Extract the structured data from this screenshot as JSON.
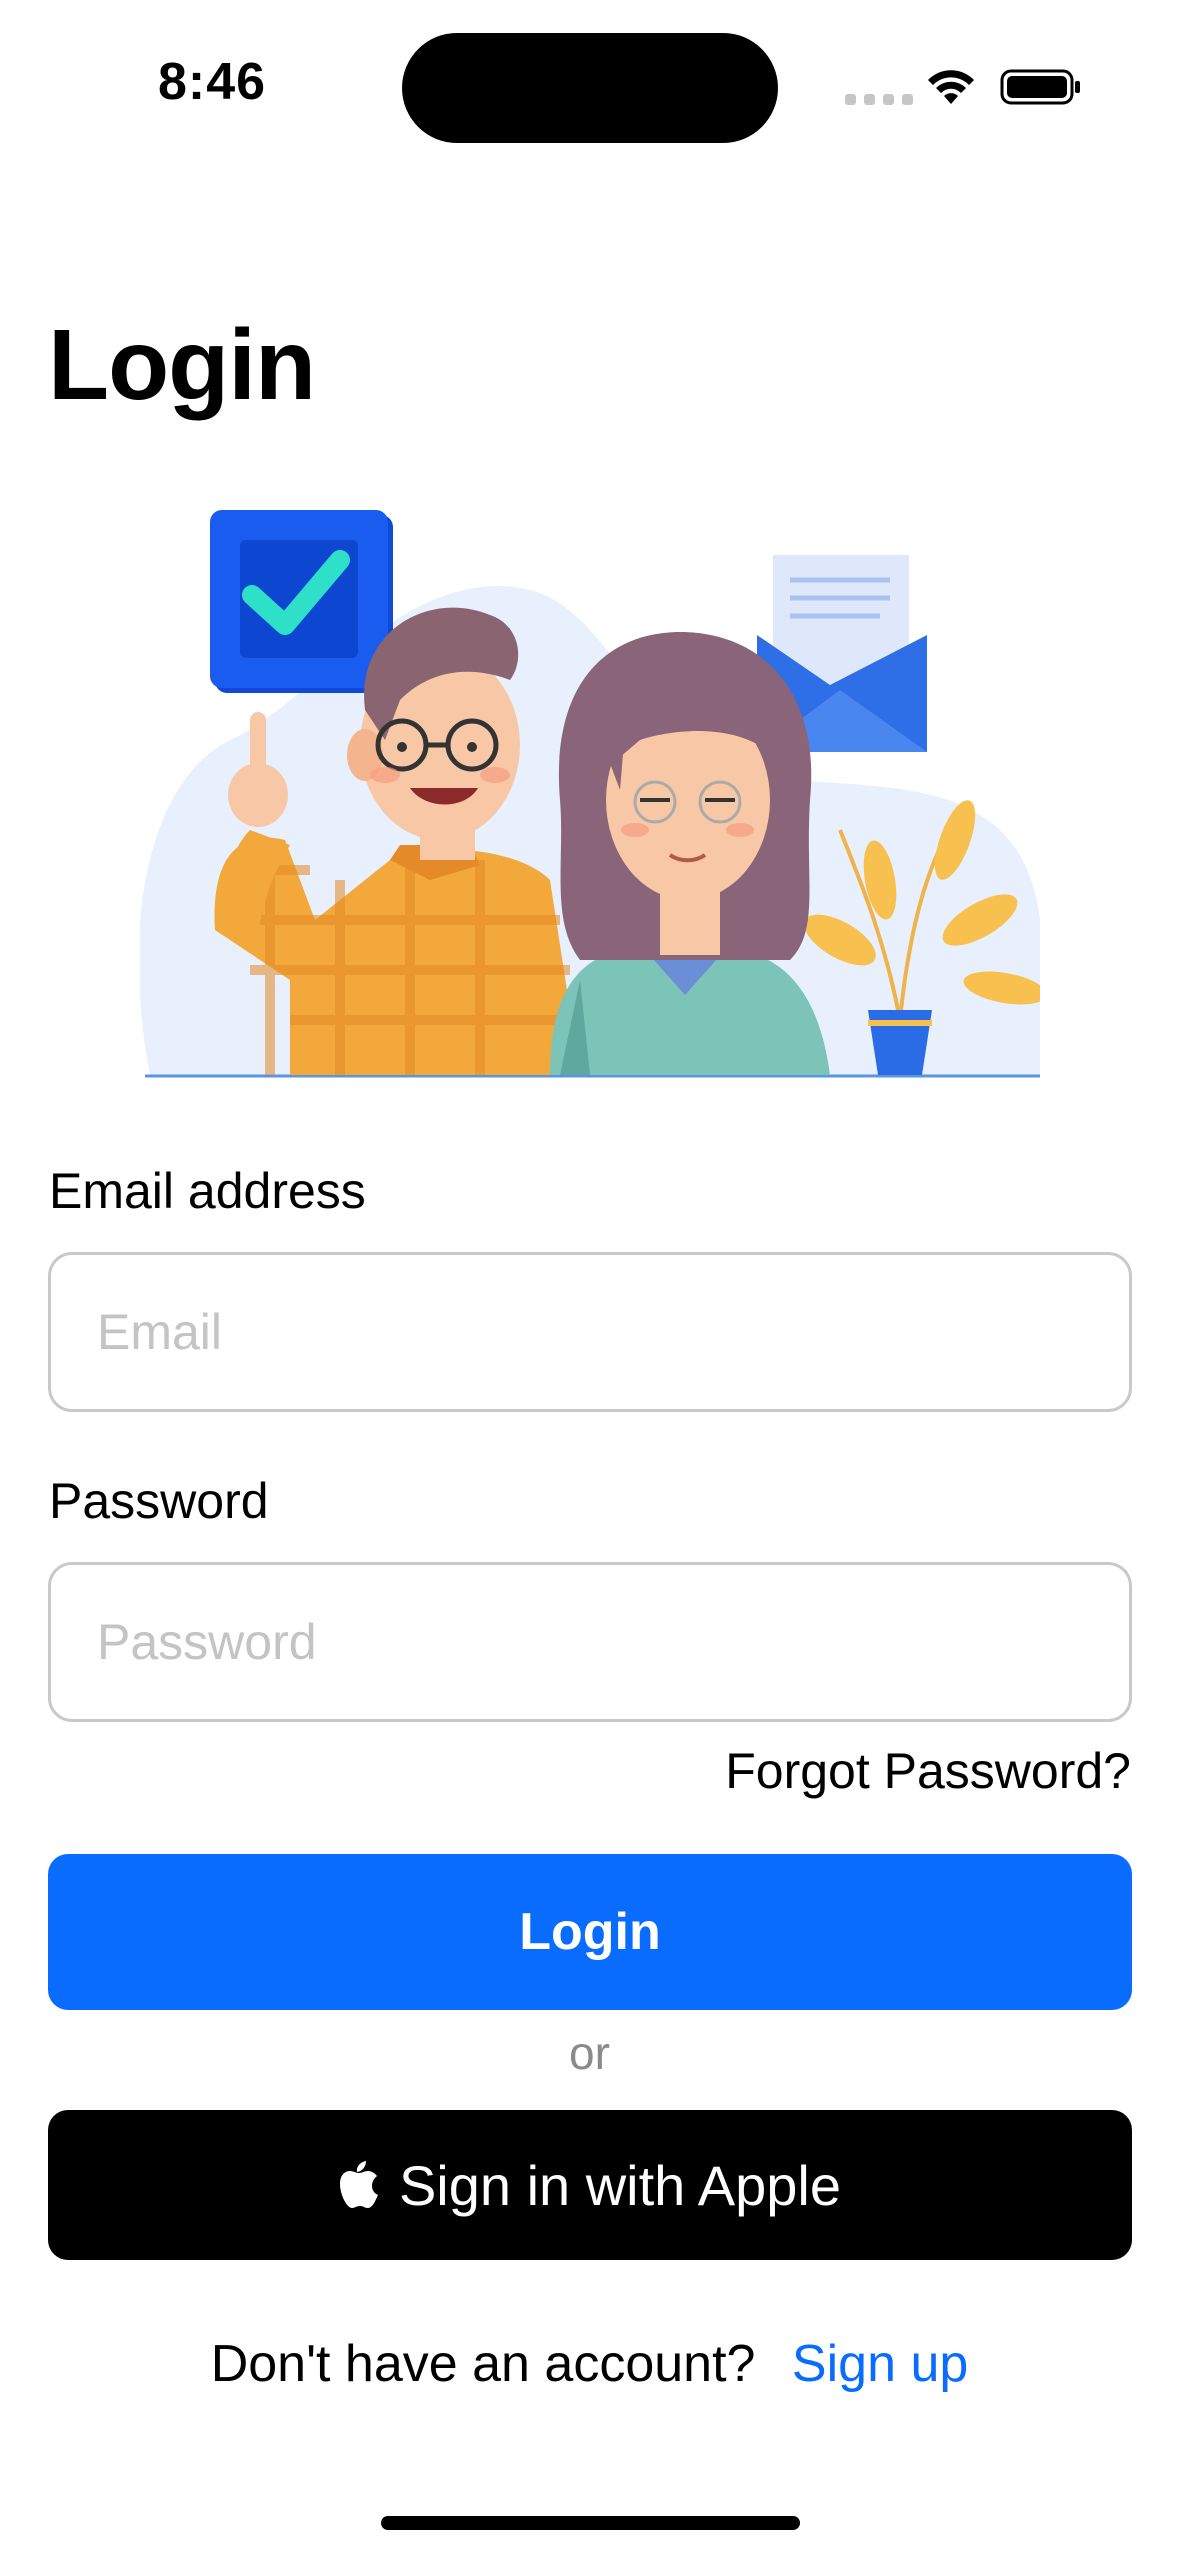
{
  "status_bar": {
    "time": "8:46"
  },
  "page": {
    "title": "Login"
  },
  "email": {
    "label": "Email address",
    "placeholder": "Email",
    "value": ""
  },
  "password": {
    "label": "Password",
    "placeholder": "Password",
    "value": ""
  },
  "forgot_password": "Forgot Password?",
  "login_button": "Login",
  "or_text": "or",
  "apple_button": "Sign in with Apple",
  "signup": {
    "prompt": "Don't have an account?",
    "link": "Sign up"
  },
  "icons": {
    "wifi": "wifi-icon",
    "battery": "battery-icon",
    "apple": "apple-logo-icon"
  },
  "colors": {
    "primary": "#0a6cff",
    "apple_button": "#000000",
    "placeholder": "#c4c4c7"
  }
}
